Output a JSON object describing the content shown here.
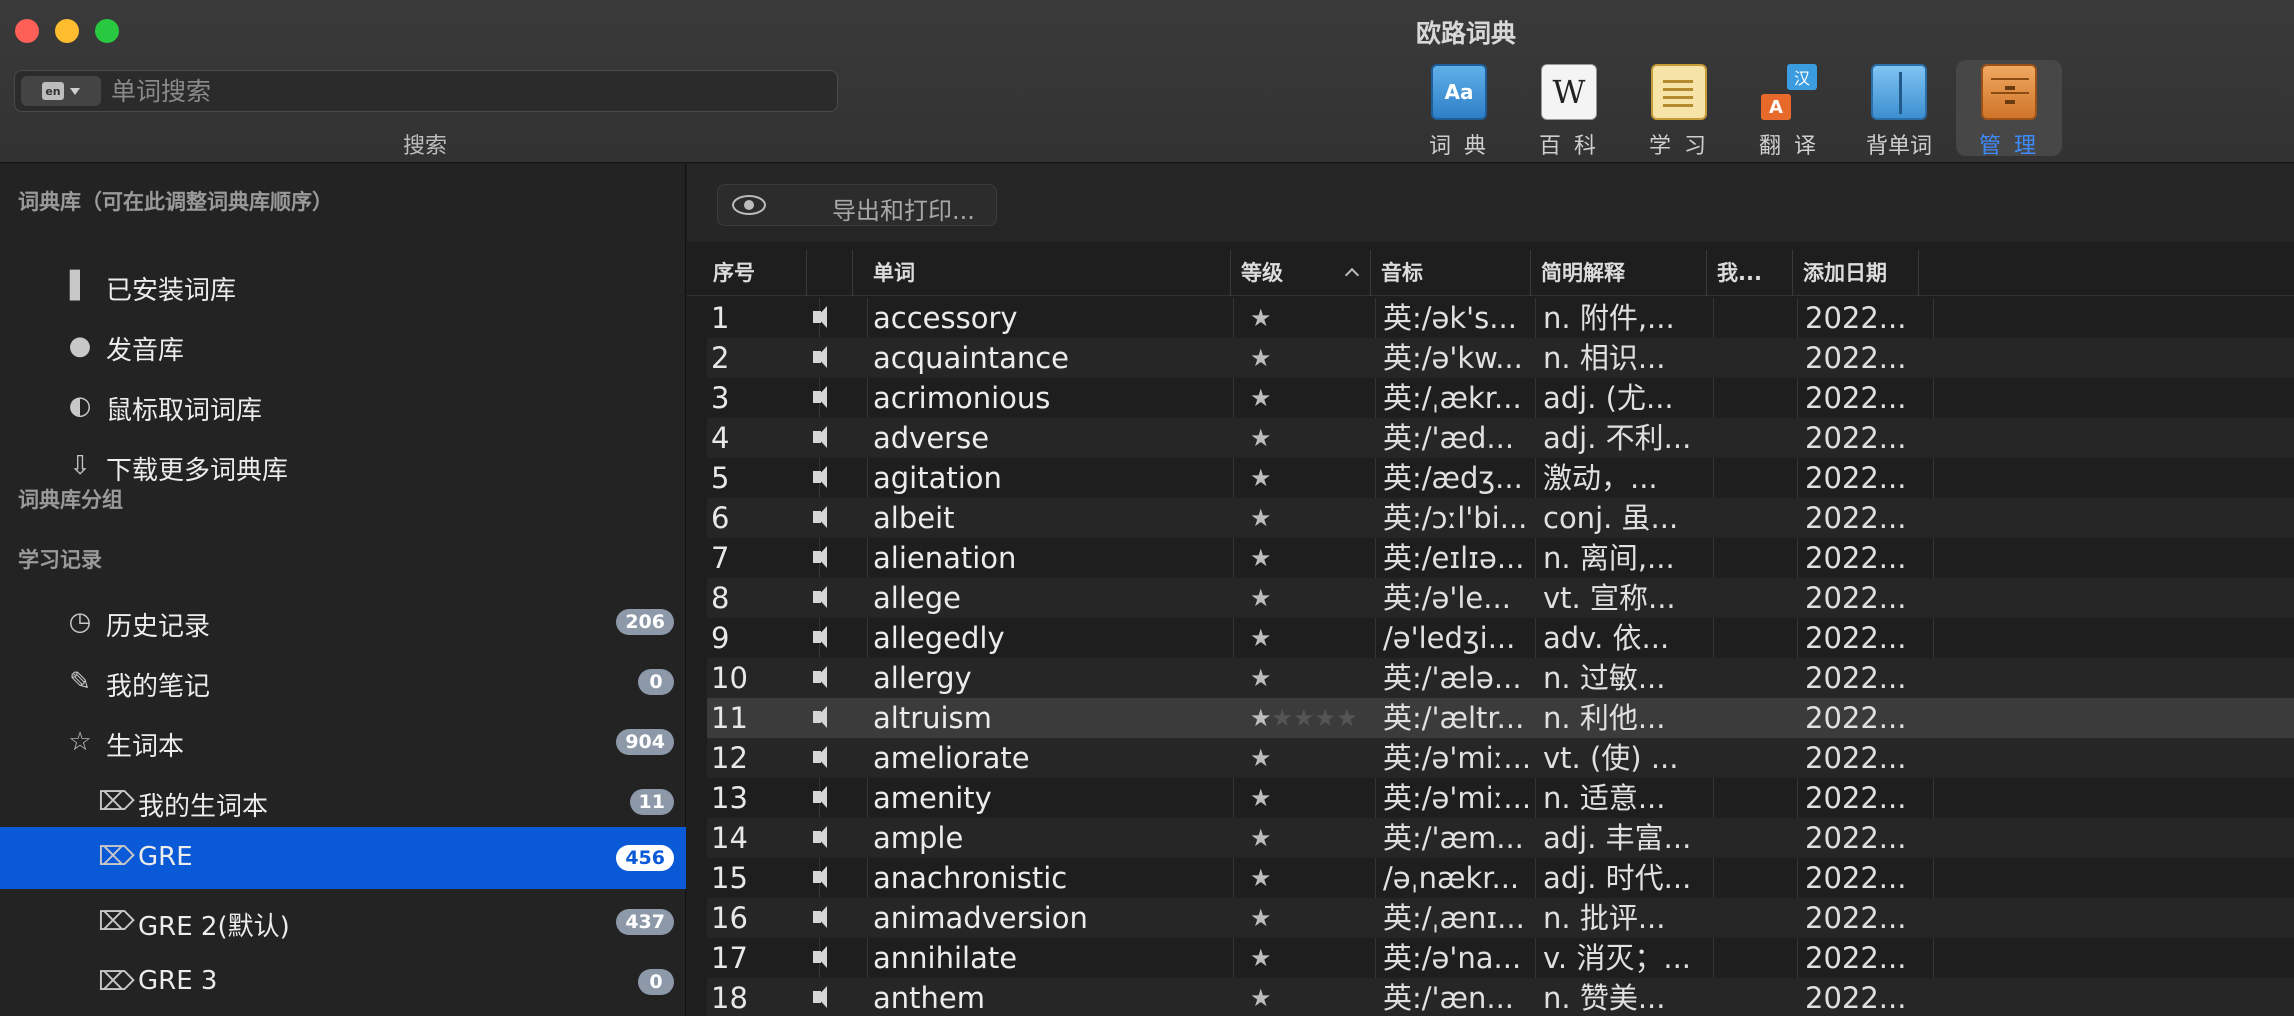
{
  "window": {
    "title": "欧路词典",
    "search_placeholder": "单词搜索",
    "search_value": "",
    "search_caption": "搜索",
    "lang_label": "en"
  },
  "toolbar": [
    {
      "label": "词 典",
      "icon": "dictionary-book-icon"
    },
    {
      "label": "百 科",
      "icon": "wikipedia-icon"
    },
    {
      "label": "学 习",
      "icon": "notepad-icon"
    },
    {
      "label": "翻 译",
      "icon": "translate-icon"
    },
    {
      "label": "背单词",
      "icon": "open-book-icon"
    },
    {
      "label": "管 理",
      "icon": "cabinet-icon",
      "active": true
    }
  ],
  "sidebar": {
    "header_library": "词典库（可在此调整词典库顺序）",
    "library_items": [
      {
        "label": "已安装词库",
        "icon": "book-icon"
      },
      {
        "label": "发音库",
        "icon": "speech-bubble-icon"
      },
      {
        "label": "鼠标取词词库",
        "icon": "mouse-icon"
      },
      {
        "label": "下载更多词典库",
        "icon": "download-arrow-icon"
      }
    ],
    "header_groups": "词典库分组",
    "header_study": "学习记录",
    "study_items": [
      {
        "label": "历史记录",
        "badge": "206",
        "icon": "clock-icon"
      },
      {
        "label": "我的笔记",
        "badge": "0",
        "icon": "pencil-icon"
      },
      {
        "label": "生词本",
        "badge": "904",
        "icon": "star-icon"
      }
    ],
    "wordbooks": [
      {
        "label": "我的生词本",
        "badge": "11",
        "icon": "tag-icon"
      },
      {
        "label": "GRE",
        "badge": "456",
        "icon": "tag-icon",
        "selected": true
      },
      {
        "label": "GRE 2(默认)",
        "badge": "437",
        "icon": "tag-icon"
      },
      {
        "label": "GRE 3",
        "badge": "0",
        "icon": "tag-icon"
      }
    ]
  },
  "main": {
    "export_label": "导出和打印...",
    "columns": {
      "num": "序号",
      "word": "单词",
      "level": "等级",
      "phonetic": "音标",
      "definition": "简明解释",
      "mine": "我...",
      "date": "添加日期"
    },
    "rows": [
      {
        "num": "1",
        "word": "accessory",
        "phonetic": "英:/ək's...",
        "definition": "n. 附件,...",
        "date": "2022..."
      },
      {
        "num": "2",
        "word": "acquaintance",
        "phonetic": "英:/ə'kw...",
        "definition": "n. 相识...",
        "date": "2022..."
      },
      {
        "num": "3",
        "word": "acrimonious",
        "phonetic": "英:/ˌækr...",
        "definition": "adj. (尤...",
        "date": "2022..."
      },
      {
        "num": "4",
        "word": "adverse",
        "phonetic": "英:/'æd...",
        "definition": "adj. 不利...",
        "date": "2022..."
      },
      {
        "num": "5",
        "word": "agitation",
        "phonetic": "英:/ædʒ...",
        "definition": "激动，...",
        "date": "2022..."
      },
      {
        "num": "6",
        "word": "albeit",
        "phonetic": "英:/ɔːl'bi...",
        "definition": "conj. 虽...",
        "date": "2022..."
      },
      {
        "num": "7",
        "word": "alienation",
        "phonetic": "英:/eɪlɪə...",
        "definition": "n. 离间,...",
        "date": "2022..."
      },
      {
        "num": "8",
        "word": "allege",
        "phonetic": "英:/ə'le...",
        "definition": "vt. 宣称...",
        "date": "2022..."
      },
      {
        "num": "9",
        "word": "allegedly",
        "phonetic": "/ə'ledʒi...",
        "definition": "adv. 依...",
        "date": "2022..."
      },
      {
        "num": "10",
        "word": "allergy",
        "phonetic": "英:/'ælə...",
        "definition": "n. 过敏...",
        "date": "2022..."
      },
      {
        "num": "11",
        "word": "altruism",
        "phonetic": "英:/'æltr...",
        "definition": "n. 利他...",
        "date": "2022...",
        "highlight": true
      },
      {
        "num": "12",
        "word": "ameliorate",
        "phonetic": "英:/ə'miː...",
        "definition": "vt. (使) ...",
        "date": "2022..."
      },
      {
        "num": "13",
        "word": "amenity",
        "phonetic": "英:/ə'miː...",
        "definition": "n. 适意...",
        "date": "2022..."
      },
      {
        "num": "14",
        "word": "ample",
        "phonetic": "英:/'æm...",
        "definition": "adj. 丰富...",
        "date": "2022..."
      },
      {
        "num": "15",
        "word": "anachronistic",
        "phonetic": "/əˌnækr...",
        "definition": "adj. 时代...",
        "date": "2022..."
      },
      {
        "num": "16",
        "word": "animadversion",
        "phonetic": "英:/ˌænɪ...",
        "definition": "n. 批评...",
        "date": "2022..."
      },
      {
        "num": "17",
        "word": "annihilate",
        "phonetic": "英:/ə'na...",
        "definition": "v. 消灭；...",
        "date": "2022..."
      },
      {
        "num": "18",
        "word": "anthem",
        "phonetic": "英:/'æn...",
        "definition": "n. 赞美...",
        "date": "2022..."
      }
    ]
  }
}
